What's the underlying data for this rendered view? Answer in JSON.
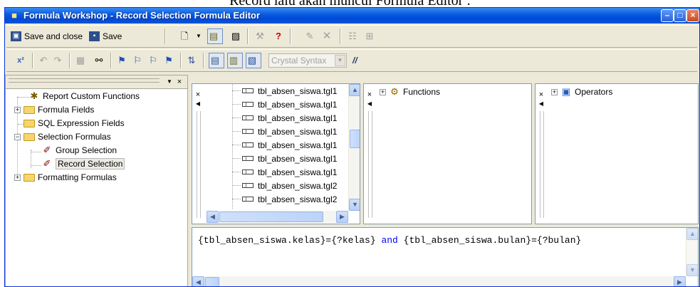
{
  "caption": "Record lalu akan muncul Formula Editor :",
  "window": {
    "title": "Formula Workshop - Record Selection Formula Editor"
  },
  "toolbar1": {
    "save_and_close": "Save and close",
    "save": "Save"
  },
  "toolbar2": {
    "syntax_combo": "Crystal Syntax",
    "comment_label": "//"
  },
  "tree": {
    "items": [
      {
        "label": "Report Custom Functions",
        "expander": ""
      },
      {
        "label": "Formula Fields",
        "expander": "+"
      },
      {
        "label": "SQL Expression Fields",
        "expander": ""
      },
      {
        "label": "Selection Formulas",
        "expander": "−"
      },
      {
        "label": "Group Selection",
        "expander": ""
      },
      {
        "label": "Record Selection",
        "expander": ""
      },
      {
        "label": "Formatting Formulas",
        "expander": "+"
      }
    ]
  },
  "fields": [
    "tbl_absen_siswa.tgl1",
    "tbl_absen_siswa.tgl1",
    "tbl_absen_siswa.tgl1",
    "tbl_absen_siswa.tgl1",
    "tbl_absen_siswa.tgl1",
    "tbl_absen_siswa.tgl1",
    "tbl_absen_siswa.tgl1",
    "tbl_absen_siswa.tgl2",
    "tbl_absen_siswa.tgl2"
  ],
  "functions_node": "Functions",
  "operators_node": "Operators",
  "formula": {
    "part1": "{tbl_absen_siswa.kelas}={?kelas} ",
    "keyword": "and",
    "part2": " {tbl_absen_siswa.bulan}={?bulan}"
  }
}
